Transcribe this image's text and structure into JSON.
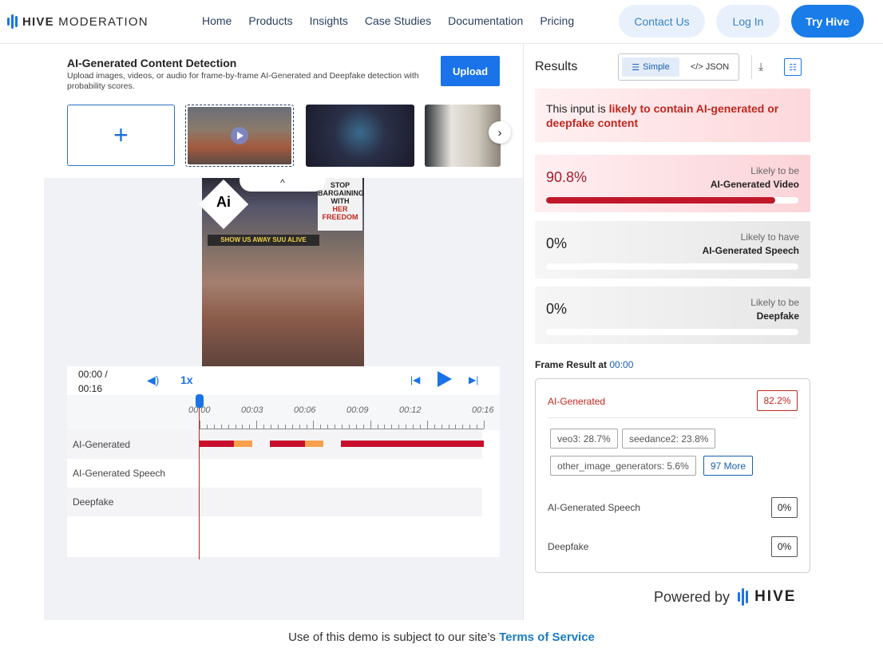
{
  "header": {
    "logo_bold": "HIVE",
    "logo_light": " MODERATION",
    "nav": [
      "Home",
      "Products",
      "Insights",
      "Case Studies",
      "Documentation",
      "Pricing"
    ],
    "contact": "Contact Us",
    "login": "Log In",
    "try": "Try Hive"
  },
  "upload_panel": {
    "title": "AI-Generated Content Detection",
    "subtitle": "Upload images, videos, or audio for frame-by-frame AI-Generated and Deepfake detection with probability scores.",
    "upload_label": "Upload",
    "add_glyph": "+",
    "next_glyph": "›",
    "collapse_glyph": "^"
  },
  "preview": {
    "ai_badge": "Ai",
    "sign_top": "STOP",
    "sign_mid": "BARGAINING WITH",
    "sign_her": "HER",
    "sign_end": "FREEDOM",
    "banner": "SHOW US AWAY SUU ALIVE"
  },
  "player": {
    "time_current": "00:00 /",
    "time_total": "00:16",
    "speed": "1x",
    "ticks": [
      "00:00",
      "00:03",
      "00:06",
      "00:09",
      "00:12",
      "00:16"
    ],
    "rows": [
      "AI-Generated",
      "AI-Generated Speech",
      "Deepfake"
    ],
    "ai_segments": [
      {
        "start": 0.0,
        "end": 1.95,
        "level": "high"
      },
      {
        "start": 1.95,
        "end": 2.95,
        "level": "medium"
      },
      {
        "start": 3.95,
        "end": 5.95,
        "level": "high"
      },
      {
        "start": 5.95,
        "end": 6.95,
        "level": "medium"
      },
      {
        "start": 7.95,
        "end": 16.0,
        "level": "high"
      }
    ],
    "duration": 16,
    "colors": {
      "high": "#c8102e",
      "medium": "#f6a04d"
    }
  },
  "results": {
    "title": "Results",
    "simple": "Simple",
    "json": "</> JSON",
    "alert_prefix": "This input is ",
    "alert_bold": "likely to contain AI-generated or deepfake content",
    "cards": [
      {
        "pct": "90.8%",
        "line1": "Likely to be",
        "line2": "AI-Generated Video",
        "value": 0.908
      },
      {
        "pct": "0%",
        "line1": "Likely to have",
        "line2": "AI-Generated Speech",
        "value": 0
      },
      {
        "pct": "0%",
        "line1": "Likely to be",
        "line2": "Deepfake",
        "value": 0
      }
    ],
    "frame_label": "Frame Result at ",
    "frame_time": "00:00",
    "frame": {
      "ai_label": "AI-Generated",
      "ai_score": "82.2%",
      "chips": [
        "veo3: 28.7%",
        "seedance2: 23.8%",
        "other_image_generators: 5.6%"
      ],
      "more": "97 More",
      "speech_label": "AI-Generated Speech",
      "speech_score": "0%",
      "deepfake_label": "Deepfake",
      "deepfake_score": "0%"
    },
    "powered_by": "Powered by",
    "powered_brand": "HIVE"
  },
  "footer": {
    "text": "Use of this demo is subject to our site’s ",
    "link": "Terms of Service"
  },
  "colors": {
    "accent": "#1a73e8",
    "danger": "#c0271f"
  }
}
